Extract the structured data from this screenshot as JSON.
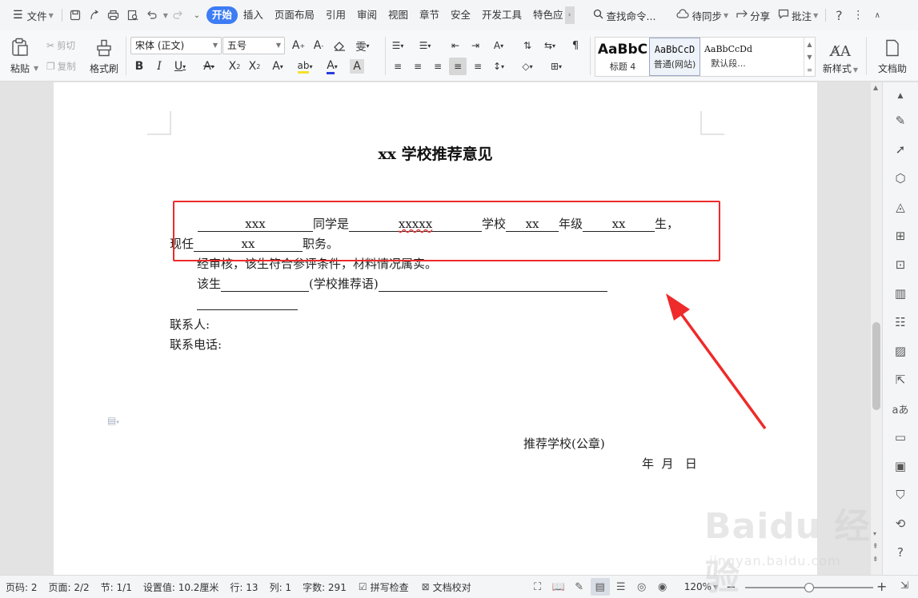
{
  "menubar": {
    "file_label": "文件",
    "tabs": [
      {
        "label": "开始",
        "active": true
      },
      {
        "label": "插入"
      },
      {
        "label": "页面布局"
      },
      {
        "label": "引用"
      },
      {
        "label": "审阅"
      },
      {
        "label": "视图"
      },
      {
        "label": "章节"
      },
      {
        "label": "安全"
      },
      {
        "label": "开发工具"
      },
      {
        "label": "特色应"
      }
    ],
    "search_label": "查找命令...",
    "sync_label": "待同步",
    "share_label": "分享",
    "comment_label": "批注",
    "help_icon": "?"
  },
  "ribbon": {
    "paste_label": "粘贴",
    "cut_label": "剪切",
    "copy_label": "复制",
    "format_painter_label": "格式刷",
    "font_name": "宋体 (正文)",
    "font_size": "五号",
    "styles": [
      {
        "sample": "AaBbC",
        "name": "标题 4"
      },
      {
        "sample": "AaBbCcD",
        "name": "普通(网站)"
      },
      {
        "sample": "AaBbCcDd",
        "name": "默认段..."
      }
    ],
    "new_style_label": "新样式",
    "doc_helper_label": "文档助"
  },
  "document": {
    "title": "xx 学校推荐意见",
    "line1": {
      "student": "xxx",
      "text1": "同学是",
      "school": "xxxxx",
      "text2": "学校",
      "grade": "xx",
      "text3": "年级",
      "class_no": "xx",
      "text4": "生，"
    },
    "line2": {
      "prefix": "现任",
      "position": "xx",
      "suffix": "职务。"
    },
    "line3": "经审核，该生符合参评条件，材料情况属实。",
    "line4": {
      "prefix": "该生",
      "mid": "(学校推荐语)"
    },
    "contact_label": "联系人:",
    "phone_label": "联系电话:",
    "stamp_label": "推荐学校(公章)",
    "date_label": "年  月   日"
  },
  "statusbar": {
    "page_num": "页码: 2",
    "pages": "页面: 2/2",
    "section": "节: 1/1",
    "setting": "设置值: 10.2厘米",
    "row": "行: 13",
    "col": "列: 1",
    "word_count": "字数: 291",
    "spell_check": "拼写检查",
    "doc_check": "文档校对",
    "zoom": "120%",
    "zoom_level": 0.5
  },
  "watermark": {
    "brand": "Baidu 经验",
    "url": "jingyan.baidu.com"
  },
  "colors": {
    "accent": "#3d7cf4",
    "annotation_red": "#ee2a2a"
  }
}
